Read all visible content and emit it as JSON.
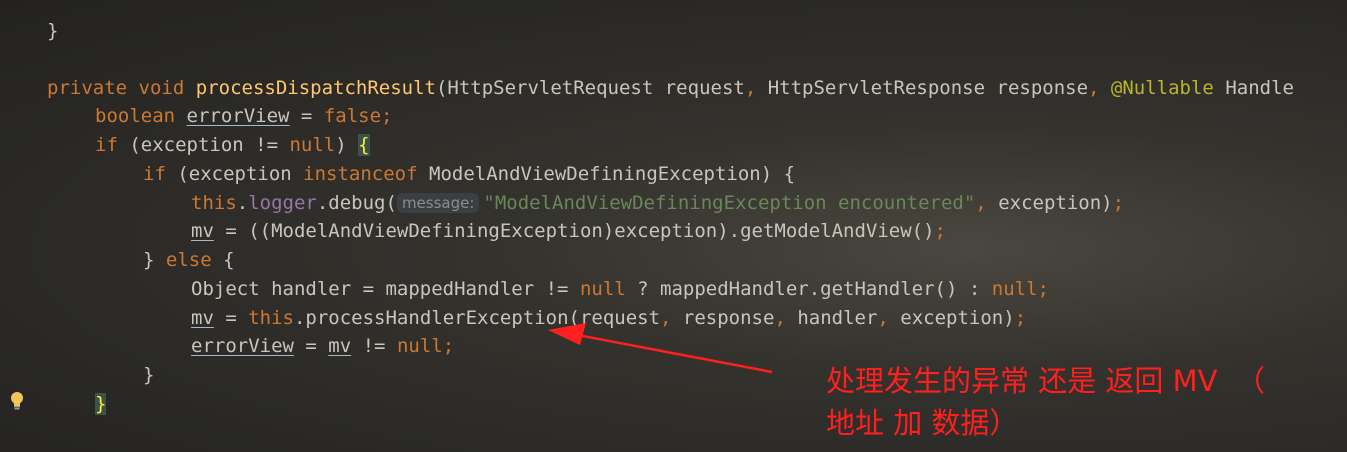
{
  "code": {
    "l1_brace": "}",
    "l2_private": "private",
    "l2_void": "void",
    "l2_method": "processDispatchResult",
    "l2_open": "(HttpServletRequest request",
    "l2_comma1": ",",
    "l2_resp": " HttpServletResponse response",
    "l2_comma2": ",",
    "l2_ann": "@Nullable",
    "l2_handle": " Handle",
    "l3_boolean": "boolean",
    "l3_var": "errorView",
    "l3_eq": " = ",
    "l3_false": "false;",
    "l4_if": "if",
    "l4_mid": " (exception != ",
    "l4_null": "null",
    "l4_close": ") ",
    "l4_brace": "{",
    "l5_if": "if",
    "l5_mid": " (exception ",
    "l5_instanceof": "instanceof",
    "l5_rest": " ModelAndViewDefiningException) {",
    "l6_this": "this",
    "l6_dot": ".",
    "l6_logger": "logger",
    "l6_debug": ".debug(",
    "l6_hint": "message:",
    "l6_str": "\"ModelAndViewDefiningException encountered\"",
    "l6_comma": ",",
    "l6_exc": " exception)",
    "l6_semi": ";",
    "l7_mv": "mv",
    "l7_rest": " = ((ModelAndViewDefiningException)exception).getModelAndView()",
    "l7_semi": ";",
    "l8_close": "} ",
    "l8_else": "else",
    "l8_brace": " {",
    "l9_obj": "Object handler = mappedHandler != ",
    "l9_null1": "null",
    "l9_mid": " ? mappedHandler.getHandler() : ",
    "l9_null2": "null;",
    "l10_mv": "mv",
    "l10_eq": " = ",
    "l10_this": "this",
    "l10_call": ".processHandlerException(request",
    "l10_c1": ",",
    "l10_resp": " response",
    "l10_c2": ",",
    "l10_handler": " handler",
    "l10_c3": ",",
    "l10_exc": " exception)",
    "l10_semi": ";",
    "l11_var": "errorView",
    "l11_eq": " = ",
    "l11_mv": "mv",
    "l11_ne": " != ",
    "l11_null": "null;",
    "l12_brace": "}",
    "l13_brace": "}"
  },
  "annotation": {
    "line1": "处理发生的异常 还是 返回 MV  （",
    "line2": "地址 加 数据）"
  },
  "icons": {
    "gutter": "lightbulb-icon",
    "annotation": "red-arrow"
  },
  "colors": {
    "keyword": "#cc7832",
    "method": "#ffc66d",
    "field": "#9876aa",
    "string": "#6a8759",
    "annotation_text": "#ff1f1f"
  }
}
